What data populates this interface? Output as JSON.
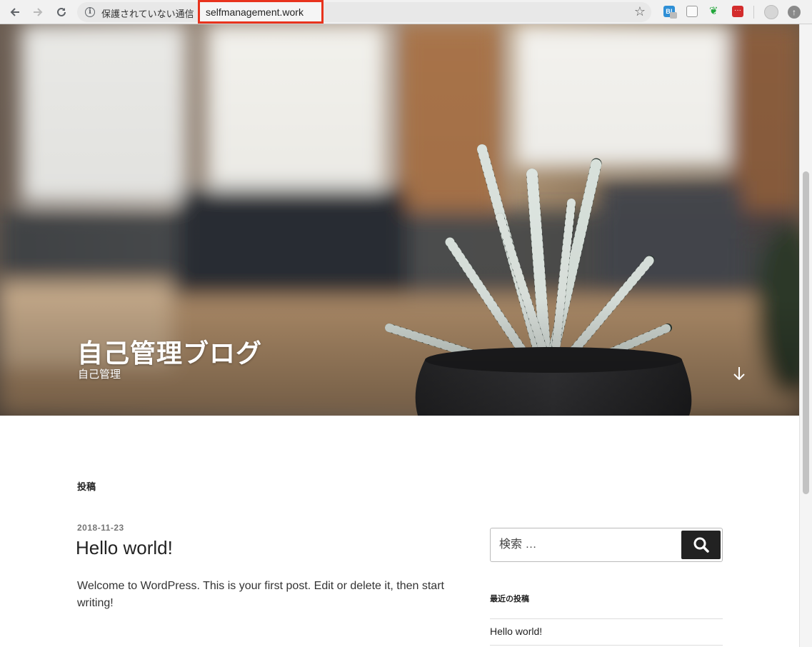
{
  "browser": {
    "security_label": "保護されていない通信",
    "url": "selfmanagement.work",
    "icons": [
      "back-arrow-icon",
      "forward-arrow-icon",
      "reload-icon",
      "info-icon",
      "star-icon",
      "hatena-bookmark-extension-icon",
      "blank-extension-icon",
      "evernote-extension-icon",
      "pocket-extension-icon",
      "profile-avatar-icon",
      "update-icon"
    ],
    "highlight_color": "#e8331d"
  },
  "header": {
    "site_title": "自己管理ブログ",
    "site_description": "自己管理"
  },
  "main": {
    "section_title": "投稿",
    "post": {
      "date": "2018-11-23",
      "title": "Hello world!",
      "excerpt": "Welcome to WordPress. This is your first post. Edit or delete it, then start writing!"
    }
  },
  "sidebar": {
    "search": {
      "placeholder": "検索 …"
    },
    "recent_posts": {
      "title": "最近の投稿",
      "items": [
        "Hello world!"
      ]
    }
  }
}
